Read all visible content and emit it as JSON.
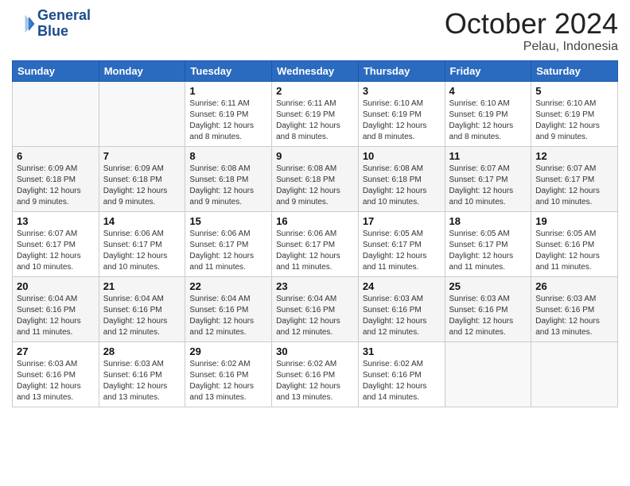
{
  "header": {
    "logo_line1": "General",
    "logo_line2": "Blue",
    "month": "October 2024",
    "location": "Pelau, Indonesia"
  },
  "days_of_week": [
    "Sunday",
    "Monday",
    "Tuesday",
    "Wednesday",
    "Thursday",
    "Friday",
    "Saturday"
  ],
  "weeks": [
    [
      {
        "day": "",
        "info": ""
      },
      {
        "day": "",
        "info": ""
      },
      {
        "day": "1",
        "info": "Sunrise: 6:11 AM\nSunset: 6:19 PM\nDaylight: 12 hours and 8 minutes."
      },
      {
        "day": "2",
        "info": "Sunrise: 6:11 AM\nSunset: 6:19 PM\nDaylight: 12 hours and 8 minutes."
      },
      {
        "day": "3",
        "info": "Sunrise: 6:10 AM\nSunset: 6:19 PM\nDaylight: 12 hours and 8 minutes."
      },
      {
        "day": "4",
        "info": "Sunrise: 6:10 AM\nSunset: 6:19 PM\nDaylight: 12 hours and 8 minutes."
      },
      {
        "day": "5",
        "info": "Sunrise: 6:10 AM\nSunset: 6:19 PM\nDaylight: 12 hours and 9 minutes."
      }
    ],
    [
      {
        "day": "6",
        "info": "Sunrise: 6:09 AM\nSunset: 6:18 PM\nDaylight: 12 hours and 9 minutes."
      },
      {
        "day": "7",
        "info": "Sunrise: 6:09 AM\nSunset: 6:18 PM\nDaylight: 12 hours and 9 minutes."
      },
      {
        "day": "8",
        "info": "Sunrise: 6:08 AM\nSunset: 6:18 PM\nDaylight: 12 hours and 9 minutes."
      },
      {
        "day": "9",
        "info": "Sunrise: 6:08 AM\nSunset: 6:18 PM\nDaylight: 12 hours and 9 minutes."
      },
      {
        "day": "10",
        "info": "Sunrise: 6:08 AM\nSunset: 6:18 PM\nDaylight: 12 hours and 10 minutes."
      },
      {
        "day": "11",
        "info": "Sunrise: 6:07 AM\nSunset: 6:17 PM\nDaylight: 12 hours and 10 minutes."
      },
      {
        "day": "12",
        "info": "Sunrise: 6:07 AM\nSunset: 6:17 PM\nDaylight: 12 hours and 10 minutes."
      }
    ],
    [
      {
        "day": "13",
        "info": "Sunrise: 6:07 AM\nSunset: 6:17 PM\nDaylight: 12 hours and 10 minutes."
      },
      {
        "day": "14",
        "info": "Sunrise: 6:06 AM\nSunset: 6:17 PM\nDaylight: 12 hours and 10 minutes."
      },
      {
        "day": "15",
        "info": "Sunrise: 6:06 AM\nSunset: 6:17 PM\nDaylight: 12 hours and 11 minutes."
      },
      {
        "day": "16",
        "info": "Sunrise: 6:06 AM\nSunset: 6:17 PM\nDaylight: 12 hours and 11 minutes."
      },
      {
        "day": "17",
        "info": "Sunrise: 6:05 AM\nSunset: 6:17 PM\nDaylight: 12 hours and 11 minutes."
      },
      {
        "day": "18",
        "info": "Sunrise: 6:05 AM\nSunset: 6:17 PM\nDaylight: 12 hours and 11 minutes."
      },
      {
        "day": "19",
        "info": "Sunrise: 6:05 AM\nSunset: 6:16 PM\nDaylight: 12 hours and 11 minutes."
      }
    ],
    [
      {
        "day": "20",
        "info": "Sunrise: 6:04 AM\nSunset: 6:16 PM\nDaylight: 12 hours and 11 minutes."
      },
      {
        "day": "21",
        "info": "Sunrise: 6:04 AM\nSunset: 6:16 PM\nDaylight: 12 hours and 12 minutes."
      },
      {
        "day": "22",
        "info": "Sunrise: 6:04 AM\nSunset: 6:16 PM\nDaylight: 12 hours and 12 minutes."
      },
      {
        "day": "23",
        "info": "Sunrise: 6:04 AM\nSunset: 6:16 PM\nDaylight: 12 hours and 12 minutes."
      },
      {
        "day": "24",
        "info": "Sunrise: 6:03 AM\nSunset: 6:16 PM\nDaylight: 12 hours and 12 minutes."
      },
      {
        "day": "25",
        "info": "Sunrise: 6:03 AM\nSunset: 6:16 PM\nDaylight: 12 hours and 12 minutes."
      },
      {
        "day": "26",
        "info": "Sunrise: 6:03 AM\nSunset: 6:16 PM\nDaylight: 12 hours and 13 minutes."
      }
    ],
    [
      {
        "day": "27",
        "info": "Sunrise: 6:03 AM\nSunset: 6:16 PM\nDaylight: 12 hours and 13 minutes."
      },
      {
        "day": "28",
        "info": "Sunrise: 6:03 AM\nSunset: 6:16 PM\nDaylight: 12 hours and 13 minutes."
      },
      {
        "day": "29",
        "info": "Sunrise: 6:02 AM\nSunset: 6:16 PM\nDaylight: 12 hours and 13 minutes."
      },
      {
        "day": "30",
        "info": "Sunrise: 6:02 AM\nSunset: 6:16 PM\nDaylight: 12 hours and 13 minutes."
      },
      {
        "day": "31",
        "info": "Sunrise: 6:02 AM\nSunset: 6:16 PM\nDaylight: 12 hours and 14 minutes."
      },
      {
        "day": "",
        "info": ""
      },
      {
        "day": "",
        "info": ""
      }
    ]
  ]
}
